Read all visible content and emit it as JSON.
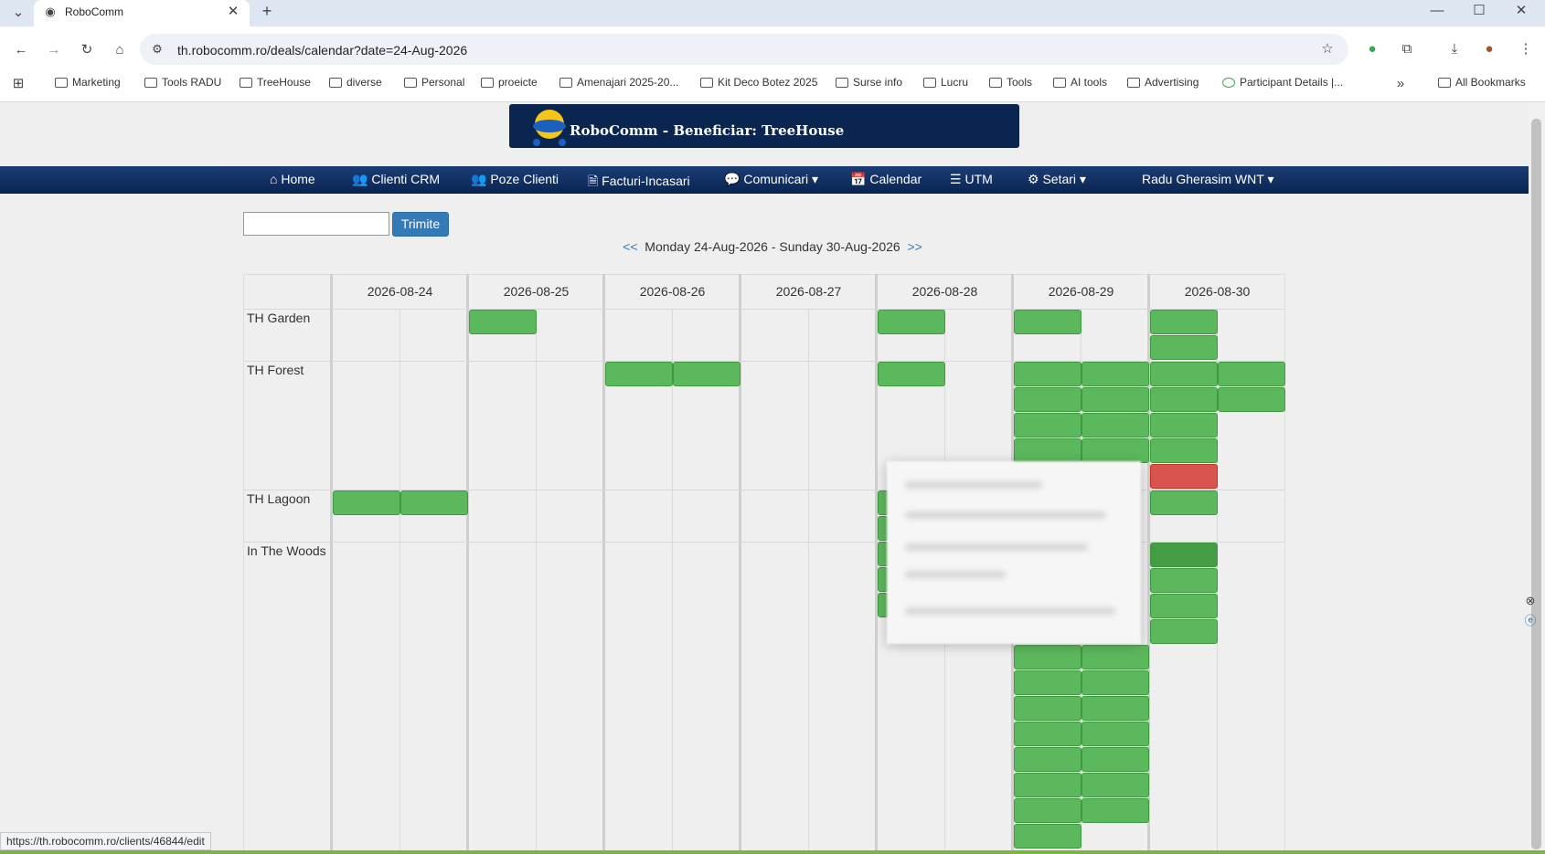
{
  "browser": {
    "tab_title": "RoboComm",
    "new_tab": "+",
    "url": "th.robocomm.ro/deals/calendar?date=24-Aug-2026",
    "bookmarks": [
      "Marketing",
      "Tools RADU",
      "TreeHouse",
      "diverse",
      "Personal",
      "proeicte",
      "Amenajari 2025-20...",
      "Kit Deco Botez 2025",
      "Surse info",
      "Lucru",
      "Tools",
      "AI tools",
      "Advertising",
      "Participant Details |..."
    ],
    "all_bookmarks": "All Bookmarks",
    "status_url": "https://th.robocomm.ro/clients/46844/edit"
  },
  "header": {
    "title": "RoboComm - Beneficiar: TreeHouse"
  },
  "nav": [
    "Home",
    "Clienti CRM",
    "Poze Clienti",
    "Facturi-Incasari",
    "Comunicari",
    "Calendar",
    "UTM",
    "Setari",
    "Radu Gherasim WNT"
  ],
  "search": {
    "button": "Trimite",
    "value": ""
  },
  "week": {
    "prev": "<<",
    "label": "Monday 24-Aug-2026 - Sunday 30-Aug-2026",
    "next": ">>"
  },
  "calendar": {
    "dates": [
      "2026-08-24",
      "2026-08-25",
      "2026-08-26",
      "2026-08-27",
      "2026-08-28",
      "2026-08-29",
      "2026-08-30"
    ],
    "rooms": [
      "TH Garden",
      "TH Forest",
      "TH Lagoon",
      "In The Woods"
    ]
  },
  "colors": {
    "booked": "#5cb85c",
    "booked_dark": "#449d44",
    "conflict": "#d9534f",
    "nav": "#0b2552",
    "link": "#337ab7"
  }
}
